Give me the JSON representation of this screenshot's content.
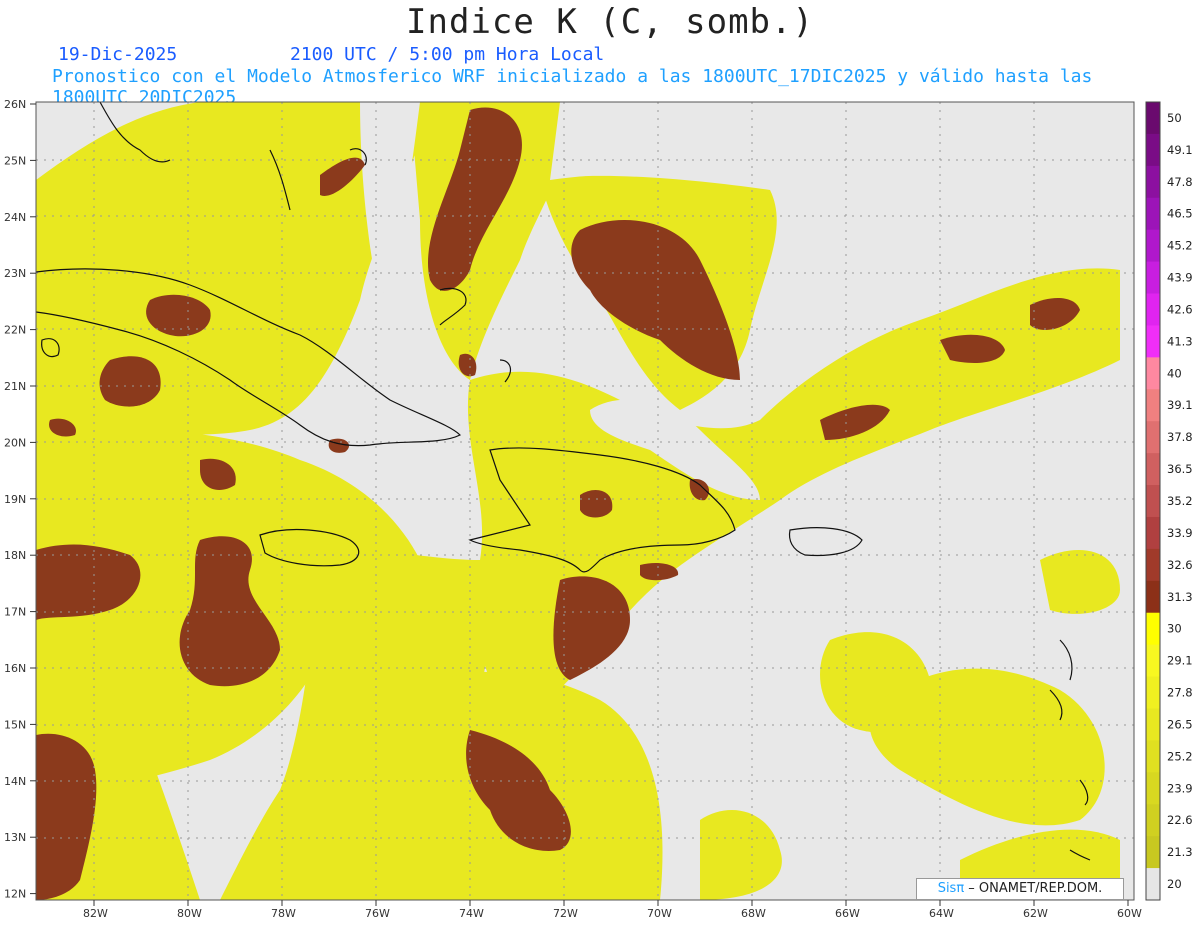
{
  "title": "Indice K (C, somb.)",
  "date": "19-Dic-2025",
  "time": "2100 UTC / 5:00 pm Hora Local",
  "forecast_line": "Pronostico con el Modelo Atmosferico WRF inicializado a las 1800UTC_17DIC2025 y válido hasta las  1800UTC_20DIC2025",
  "credit": {
    "logo": "Sisπ",
    "text": " – ONAMET/REP.DOM."
  },
  "lat_labels": [
    "26N",
    "25N",
    "24N",
    "23N",
    "22N",
    "21N",
    "20N",
    "19N",
    "18N",
    "17N",
    "16N",
    "15N",
    "14N",
    "13N",
    "12N"
  ],
  "lon_labels": [
    "82W",
    "80W",
    "78W",
    "76W",
    "74W",
    "72W",
    "70W",
    "68W",
    "66W",
    "64W",
    "62W",
    "60W"
  ],
  "colorbar": {
    "labels": [
      "50",
      "49.1",
      "47.8",
      "46.5",
      "45.2",
      "43.9",
      "42.6",
      "41.3",
      "40",
      "39.1",
      "37.8",
      "36.5",
      "35.2",
      "33.9",
      "32.6",
      "31.3",
      "30",
      "29.1",
      "27.8",
      "26.5",
      "25.2",
      "23.9",
      "22.6",
      "21.3",
      "20"
    ],
    "colors": [
      "#6a0a6e",
      "#7a0c86",
      "#8c10a0",
      "#9c14b8",
      "#b018cc",
      "#c81ee0",
      "#e024f0",
      "#f02ef8",
      "#ff88a0",
      "#f08080",
      "#e07070",
      "#d06060",
      "#c05050",
      "#b04040",
      "#a03a2a",
      "#8c3018",
      "#ffff00",
      "#f8f820",
      "#f0f020",
      "#e8e820",
      "#e0e020",
      "#d8d820",
      "#d0d020",
      "#c8c820",
      "#e6e6e6"
    ]
  }
}
